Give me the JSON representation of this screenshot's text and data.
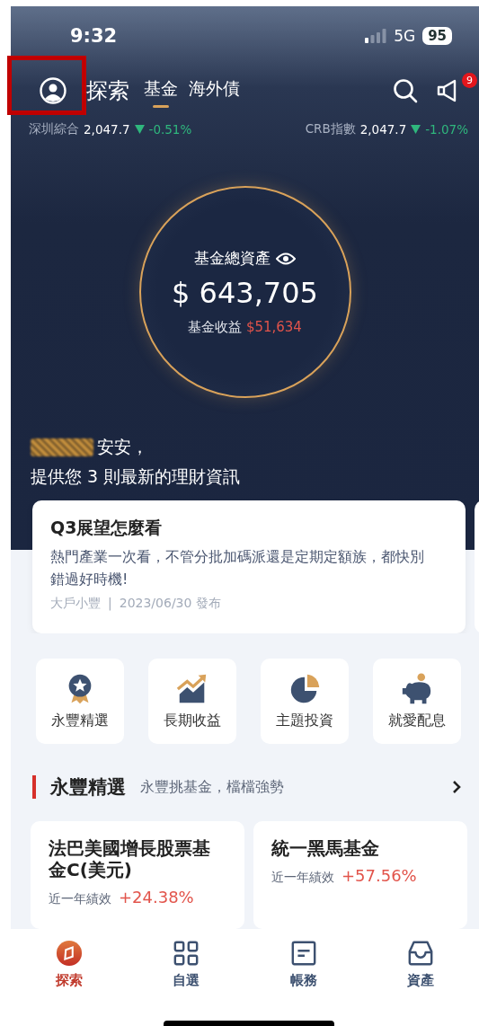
{
  "status_bar": {
    "time": "9:32",
    "network": "5G",
    "battery": "95"
  },
  "nav": {
    "title": "探索",
    "tabs": [
      {
        "label": "基金",
        "selected": true
      },
      {
        "label": "海外債",
        "selected": false
      }
    ],
    "notification_badge": "9"
  },
  "tickers": [
    {
      "name": "深圳綜合",
      "value": "2,047.7",
      "change": "-0.51%"
    },
    {
      "name": "CRB指數",
      "value": "2,047.7",
      "change": "-1.07%"
    }
  ],
  "assets": {
    "label": "基金總資產",
    "total": "$ 643,705",
    "profit_label": "基金收益",
    "profit": "$51,634"
  },
  "greeting": {
    "salutation": "安安，",
    "message": "提供您 3 則最新的理財資訊"
  },
  "news": [
    {
      "title": "Q3展望怎麼看",
      "body": "熱門產業一次看，不管分批加碼派還是定期定額族，都快別錯過好時機!",
      "source": "大戶小豐",
      "separator": "|",
      "date": "2023/06/30 發布"
    }
  ],
  "shortcuts": [
    {
      "kind": "medal",
      "label": "永豐精選"
    },
    {
      "kind": "growth",
      "label": "長期收益"
    },
    {
      "kind": "pie",
      "label": "主題投資"
    },
    {
      "kind": "piggy",
      "label": "就愛配息"
    }
  ],
  "section": {
    "title": "永豐精選",
    "subtitle": "永豐挑基金，檔檔強勢"
  },
  "funds": [
    {
      "name": "法巴美國增長股票基金C(美元)",
      "metric": "近一年績效",
      "return": "+24.38%"
    },
    {
      "name": "統一黑馬基金",
      "metric": "近一年績效",
      "return": "+57.56%"
    }
  ],
  "bottom_tabs": [
    {
      "kind": "explore",
      "label": "探索",
      "selected": true
    },
    {
      "kind": "watchlist",
      "label": "自選",
      "selected": false
    },
    {
      "kind": "accounts",
      "label": "帳務",
      "selected": false
    },
    {
      "kind": "assets",
      "label": "資產",
      "selected": false
    }
  ]
}
